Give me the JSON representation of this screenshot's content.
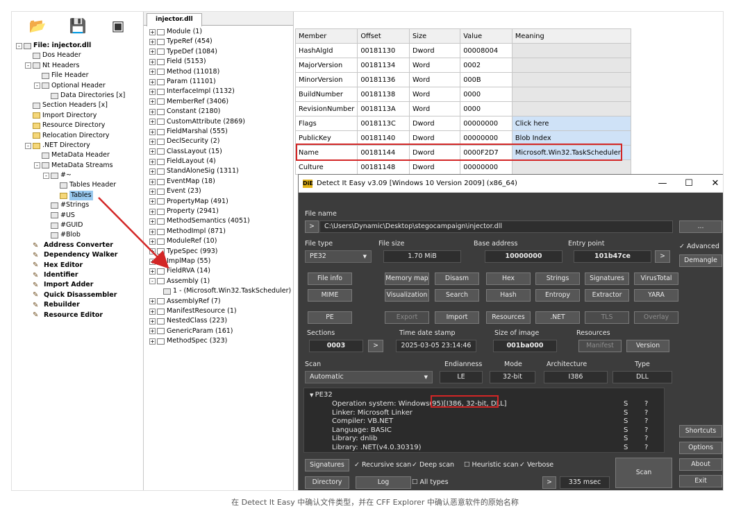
{
  "left_tree": [
    {
      "label": "File: injector.dll",
      "depth": 0,
      "exp": "-",
      "icon": "file",
      "bold": true
    },
    {
      "label": "Dos Header",
      "depth": 1,
      "icon": "doc"
    },
    {
      "label": "Nt Headers",
      "depth": 1,
      "exp": "-",
      "icon": "doc"
    },
    {
      "label": "File Header",
      "depth": 2,
      "icon": "doc"
    },
    {
      "label": "Optional Header",
      "depth": 2,
      "exp": "-",
      "icon": "doc"
    },
    {
      "label": "Data Directories [x]",
      "depth": 3,
      "icon": "doc"
    },
    {
      "label": "Section Headers [x]",
      "depth": 1,
      "icon": "doc"
    },
    {
      "label": "Import Directory",
      "depth": 1,
      "icon": "folder"
    },
    {
      "label": "Resource Directory",
      "depth": 1,
      "icon": "folder"
    },
    {
      "label": "Relocation Directory",
      "depth": 1,
      "icon": "folder"
    },
    {
      "label": ".NET Directory",
      "depth": 1,
      "exp": "-",
      "icon": "folder"
    },
    {
      "label": "MetaData Header",
      "depth": 2,
      "icon": "doc"
    },
    {
      "label": "MetaData Streams",
      "depth": 2,
      "exp": "-",
      "icon": "doc"
    },
    {
      "label": "#~",
      "depth": 3,
      "exp": "-",
      "icon": "doc"
    },
    {
      "label": "Tables Header",
      "depth": 4,
      "icon": "doc"
    },
    {
      "label": "Tables",
      "depth": 4,
      "icon": "folder",
      "selected": true
    },
    {
      "label": "#Strings",
      "depth": 3,
      "icon": "doc"
    },
    {
      "label": "#US",
      "depth": 3,
      "icon": "doc"
    },
    {
      "label": "#GUID",
      "depth": 3,
      "icon": "doc"
    },
    {
      "label": "#Blob",
      "depth": 3,
      "icon": "doc"
    },
    {
      "label": "Address Converter",
      "depth": 1,
      "icon": "tool",
      "bold": true
    },
    {
      "label": "Dependency Walker",
      "depth": 1,
      "icon": "tool",
      "bold": true
    },
    {
      "label": "Hex Editor",
      "depth": 1,
      "icon": "tool",
      "bold": true
    },
    {
      "label": "Identifier",
      "depth": 1,
      "icon": "tool",
      "bold": true
    },
    {
      "label": "Import Adder",
      "depth": 1,
      "icon": "tool",
      "bold": true
    },
    {
      "label": "Quick Disassembler",
      "depth": 1,
      "icon": "tool",
      "bold": true
    },
    {
      "label": "Rebuilder",
      "depth": 1,
      "icon": "tool",
      "bold": true
    },
    {
      "label": "Resource Editor",
      "depth": 1,
      "icon": "tool",
      "bold": true
    }
  ],
  "tab_label": "injector.dll",
  "mid_tree": [
    {
      "label": "Module (1)",
      "depth": 0,
      "exp": "+"
    },
    {
      "label": "TypeRef (454)",
      "depth": 0,
      "exp": "+"
    },
    {
      "label": "TypeDef (1084)",
      "depth": 0,
      "exp": "+"
    },
    {
      "label": "Field (5153)",
      "depth": 0,
      "exp": "+"
    },
    {
      "label": "Method (11018)",
      "depth": 0,
      "exp": "+"
    },
    {
      "label": "Param (11101)",
      "depth": 0,
      "exp": "+"
    },
    {
      "label": "InterfaceImpl (1132)",
      "depth": 0,
      "exp": "+"
    },
    {
      "label": "MemberRef (3406)",
      "depth": 0,
      "exp": "+"
    },
    {
      "label": "Constant (2180)",
      "depth": 0,
      "exp": "+"
    },
    {
      "label": "CustomAttribute (2869)",
      "depth": 0,
      "exp": "+"
    },
    {
      "label": "FieldMarshal (555)",
      "depth": 0,
      "exp": "+"
    },
    {
      "label": "DeclSecurity (2)",
      "depth": 0,
      "exp": "+"
    },
    {
      "label": "ClassLayout (15)",
      "depth": 0,
      "exp": "+"
    },
    {
      "label": "FieldLayout (4)",
      "depth": 0,
      "exp": "+"
    },
    {
      "label": "StandAloneSig (1311)",
      "depth": 0,
      "exp": "+"
    },
    {
      "label": "EventMap (18)",
      "depth": 0,
      "exp": "+"
    },
    {
      "label": "Event (23)",
      "depth": 0,
      "exp": "+"
    },
    {
      "label": "PropertyMap (491)",
      "depth": 0,
      "exp": "+"
    },
    {
      "label": "Property (2941)",
      "depth": 0,
      "exp": "+"
    },
    {
      "label": "MethodSemantics (4051)",
      "depth": 0,
      "exp": "+"
    },
    {
      "label": "MethodImpl (871)",
      "depth": 0,
      "exp": "+"
    },
    {
      "label": "ModuleRef (10)",
      "depth": 0,
      "exp": "+"
    },
    {
      "label": "TypeSpec (993)",
      "depth": 0,
      "exp": "+"
    },
    {
      "label": "ImplMap (55)",
      "depth": 0,
      "exp": "+"
    },
    {
      "label": "FieldRVA (14)",
      "depth": 0,
      "exp": "+"
    },
    {
      "label": "Assembly (1)",
      "depth": 0,
      "exp": "-"
    },
    {
      "label": "1 - (Microsoft.Win32.TaskScheduler)",
      "depth": 1,
      "doc": true
    },
    {
      "label": "AssemblyRef (7)",
      "depth": 0,
      "exp": "+"
    },
    {
      "label": "ManifestResource (1)",
      "depth": 0,
      "exp": "+"
    },
    {
      "label": "NestedClass (223)",
      "depth": 0,
      "exp": "+"
    },
    {
      "label": "GenericParam (161)",
      "depth": 0,
      "exp": "+"
    },
    {
      "label": "MethodSpec (323)",
      "depth": 0,
      "exp": "+"
    }
  ],
  "table": {
    "headers": [
      "Member",
      "Offset",
      "Size",
      "Value",
      "Meaning"
    ],
    "rows": [
      [
        "HashAlgId",
        "00181130",
        "Dword",
        "00008004",
        ""
      ],
      [
        "MajorVersion",
        "00181134",
        "Word",
        "0002",
        ""
      ],
      [
        "MinorVersion",
        "00181136",
        "Word",
        "000B",
        ""
      ],
      [
        "BuildNumber",
        "00181138",
        "Word",
        "0000",
        ""
      ],
      [
        "RevisionNumber",
        "0018113A",
        "Word",
        "0000",
        ""
      ],
      [
        "Flags",
        "0018113C",
        "Dword",
        "00000000",
        "Click here"
      ],
      [
        "PublicKey",
        "00181140",
        "Dword",
        "00000000",
        "Blob Index"
      ],
      [
        "Name",
        "00181144",
        "Dword",
        "0000F2D7",
        "Microsoft.Win32.TaskScheduler"
      ],
      [
        "Culture",
        "00181148",
        "Dword",
        "00000000",
        ""
      ]
    ]
  },
  "die": {
    "title": "Detect It Easy v3.09 [Windows 10 Version 2009] (x86_64)",
    "logo": "DiE",
    "minimize": "—",
    "maximize": "☐",
    "close": "✕",
    "file_name_label": "File name",
    "file_path": "C:\\Users\\Dynamic\\Desktop\\stegocampaign\\injector.dll",
    "path_btn": ">",
    "browse_btn": "...",
    "file_type_label": "File type",
    "file_type": "PE32",
    "file_size_label": "File size",
    "file_size": "1.70 MiB",
    "base_address_label": "Base address",
    "base_address": "10000000",
    "entry_point_label": "Entry point",
    "entry_point": "101b47ce",
    "ep_btn": ">",
    "advanced_label": "Advanced",
    "demangle_btn": "Demangle",
    "row1": [
      "File info",
      "Memory map",
      "Disasm",
      "Hex",
      "Strings",
      "Signatures",
      "VirusTotal"
    ],
    "row2": [
      "MIME",
      "Visualization",
      "Search",
      "Hash",
      "Entropy",
      "Extractor",
      "YARA"
    ],
    "row3": [
      "PE",
      "Export",
      "Import",
      "Resources",
      ".NET",
      "TLS",
      "Overlay"
    ],
    "sections_label": "Sections",
    "sections": "0003",
    "sections_btn": ">",
    "time_label": "Time date stamp",
    "time": "2025-03-05 23:14:46",
    "image_size_label": "Size of image",
    "image_size": "001ba000",
    "resources_label": "Resources",
    "manifest_btn": "Manifest",
    "version_btn": "Version",
    "scan_label": "Scan",
    "scan_value": "Automatic",
    "endianness_label": "Endianness",
    "endianness": "LE",
    "mode_label": "Mode",
    "mode": "32-bit",
    "arch_label": "Architecture",
    "arch": "I386",
    "type_label": "Type",
    "type": "DLL",
    "result_root": "PE32",
    "result_lines": [
      "Operation system: Windows(95)[I386, 32-bit, DLL]",
      "Linker: Microsoft Linker",
      "Compiler: VB.NET",
      "Language: BASIC",
      "Library: dnlib",
      "Library: .NET(v4.0.30319)"
    ],
    "result_s": "S",
    "result_q": "?",
    "shortcuts_btn": "Shortcuts",
    "options_btn": "Options",
    "signatures_btn": "Signatures",
    "recursive": "Recursive scan",
    "deep": "Deep scan",
    "heuristic": "Heuristic scan",
    "verbose": "Verbose",
    "directory_btn": "Directory",
    "log_btn": "Log",
    "all_types": "All types",
    "time_btn": ">",
    "msec": "335 msec",
    "scan_btn": "Scan",
    "about_btn": "About",
    "exit_btn": "Exit"
  },
  "caption": "在 Detect It Easy 中确认文件类型，并在 CFF Explorer 中确认恶意软件的原始名称",
  "colors": {
    "highlight_red": "#d32626",
    "die_bg": "#3c3c3c",
    "selection": "#99c9ef"
  }
}
